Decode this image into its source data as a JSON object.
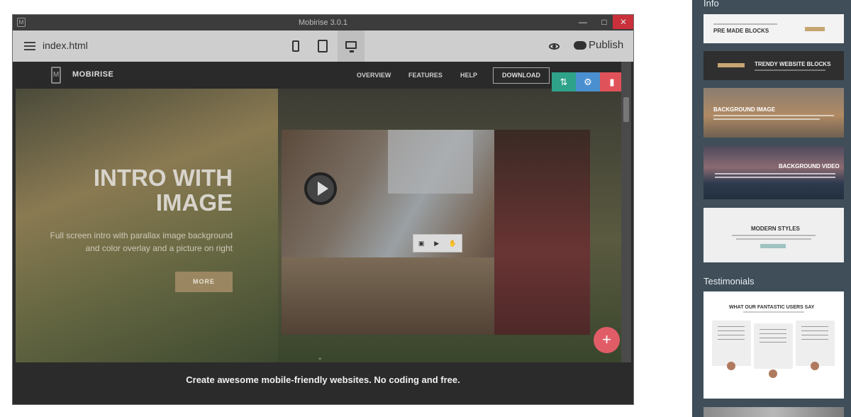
{
  "window": {
    "title": "Mobirise 3.0.1",
    "controls": {
      "minimize": "—",
      "maximize": "□",
      "close": "✕"
    }
  },
  "toolbar": {
    "filename": "index.html",
    "publish_label": "Publish",
    "active_device": "desktop"
  },
  "site": {
    "brand": "MOBIRISE",
    "brand_icon_letter": "M",
    "nav": [
      "OVERVIEW",
      "FEATURES",
      "HELP"
    ],
    "download_label": "DOWNLOAD",
    "hero_title_line1": "INTRO WITH",
    "hero_title_line2": "IMAGE",
    "hero_subtitle_line1": "Full screen intro with parallax image background",
    "hero_subtitle_line2": "and color overlay and a picture on right",
    "more_label": "MORE"
  },
  "caption": "Create awesome mobile-friendly websites. No coding and free.",
  "panel": {
    "info_heading": "Info",
    "testimonials_heading": "Testimonials",
    "cards": [
      {
        "title": "PRE MADE BLOCKS",
        "theme": "light"
      },
      {
        "title": "TRENDY WEBSITE BLOCKS",
        "theme": "dark"
      },
      {
        "title": "BACKGROUND IMAGE",
        "theme": "photo-warm"
      },
      {
        "title": "BACKGROUND VIDEO",
        "theme": "photo-dusk"
      },
      {
        "title": "MODERN STYLES",
        "theme": "light"
      }
    ],
    "testimonials_title": "WHAT OUR FANTASTIC USERS SAY"
  },
  "colors": {
    "accent_green": "#2ea38a",
    "accent_blue": "#4a90d0",
    "accent_red": "#e0525a",
    "panel_bg": "#3f4e58",
    "more_button": "#9a8660"
  }
}
